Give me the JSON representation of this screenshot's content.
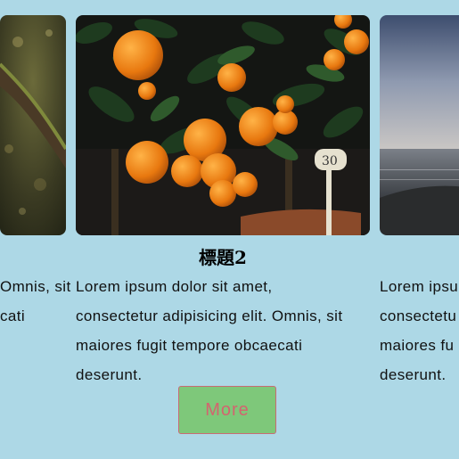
{
  "cards": [
    {
      "image": "forest-branch-photo",
      "title": "",
      "text_lines": [
        "Omnis, sit",
        "cati"
      ]
    },
    {
      "image": "orange-tree-photo",
      "title": "標題2",
      "plant_tag": "30",
      "text_lines": [
        "Lorem ipsum dolor sit amet,",
        "consectetur adipisicing elit. Omnis, sit",
        "maiores fugit tempore obcaecati",
        "deserunt."
      ]
    },
    {
      "image": "seaside-sunset-photo",
      "title": "",
      "text_lines": [
        "Lorem ipsu",
        "consectetu",
        "maiores fu",
        "deserunt."
      ]
    }
  ],
  "more_button": {
    "label": "More"
  },
  "colors": {
    "background": "#add8e6",
    "button_bg": "#7ec87a",
    "button_text": "#d3646f"
  }
}
